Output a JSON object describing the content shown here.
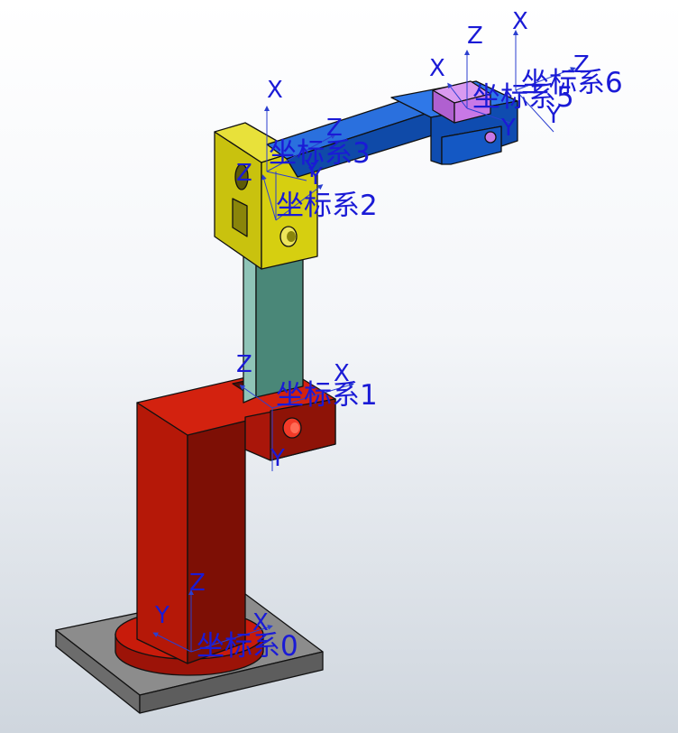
{
  "colors": {
    "base_plate": "#8a8a8a",
    "base_red": "#c41a0b",
    "link_teal": "#4a8778",
    "joint_yellow": "#d6cf10",
    "arm_blue": "#1659c8",
    "tool_violet": "#c878e6",
    "label_blue": "#1a1ad6"
  },
  "frames": [
    {
      "name": "坐标系0",
      "axes": [
        "Z",
        "Y",
        "X"
      ]
    },
    {
      "name": "坐标系1",
      "axes": [
        "Z",
        "X",
        "Y"
      ]
    },
    {
      "name": "坐标系2",
      "axes": [
        "Z",
        "Y"
      ]
    },
    {
      "name": "坐标系3",
      "axes": [
        "X",
        "Z",
        "Y"
      ]
    },
    {
      "name": "坐标系5",
      "axes": [
        "Z",
        "X",
        "Y"
      ]
    },
    {
      "name": "坐标系6",
      "axes": [
        "X",
        "Z",
        "Y"
      ]
    }
  ]
}
